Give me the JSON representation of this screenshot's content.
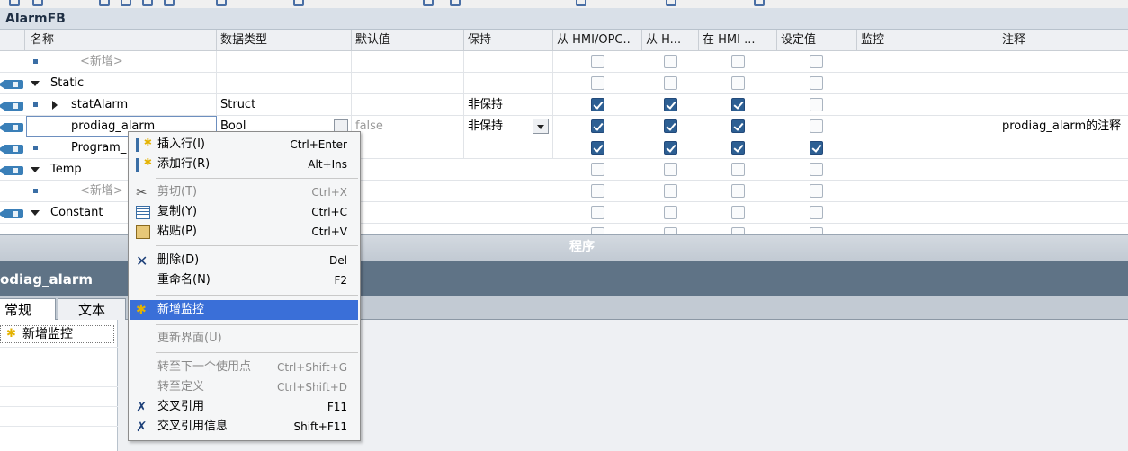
{
  "block": {
    "title": "AlarmFB"
  },
  "table": {
    "columns": [
      "名称",
      "数据类型",
      "默认值",
      "保持",
      "从 HMI/OPC..",
      "从 H...",
      "在 HMI ...",
      "设定值",
      "监控",
      "注释"
    ],
    "rows": [
      {
        "name": "<新增>",
        "type": "",
        "default": "",
        "retain": "",
        "hmi1": false,
        "hmi2": false,
        "hmi3": false,
        "setpoint": false,
        "comment": ""
      },
      {
        "name": "Static",
        "type": "",
        "default": "",
        "retain": "",
        "hmi1": false,
        "hmi2": false,
        "hmi3": false,
        "setpoint": false,
        "comment": ""
      },
      {
        "name": "statAlarm",
        "type": "Struct",
        "default": "",
        "retain": "非保持",
        "hmi1": true,
        "hmi2": true,
        "hmi3": true,
        "setpoint": false,
        "comment": ""
      },
      {
        "name": "prodiag_alarm",
        "type": "Bool",
        "default": "false",
        "retain": "非保持",
        "hmi1": true,
        "hmi2": true,
        "hmi3": true,
        "setpoint": false,
        "comment": "prodiag_alarm的注释"
      },
      {
        "name": "Program_",
        "type": "",
        "default": "",
        "retain": "",
        "hmi1": true,
        "hmi2": true,
        "hmi3": true,
        "setpoint": true,
        "comment": ""
      },
      {
        "name": "Temp",
        "type": "",
        "default": "",
        "retain": "",
        "hmi1": false,
        "hmi2": false,
        "hmi3": false,
        "setpoint": false,
        "comment": ""
      },
      {
        "name": "<新增>",
        "type": "",
        "default": "",
        "retain": "",
        "hmi1": false,
        "hmi2": false,
        "hmi3": false,
        "setpoint": false,
        "comment": ""
      },
      {
        "name": "Constant",
        "type": "",
        "default": "",
        "retain": "",
        "hmi1": false,
        "hmi2": false,
        "hmi3": false,
        "setpoint": false,
        "comment": ""
      }
    ]
  },
  "divider": {
    "label": "程序"
  },
  "inspector": {
    "title": "odiag_alarm",
    "tabs": [
      "常规",
      "文本"
    ],
    "side_item": "新增监控"
  },
  "context_menu": {
    "items": [
      {
        "label": "插入行(I)",
        "shortcut": "Ctrl+Enter",
        "icon": "insert-row-icon",
        "disabled": false
      },
      {
        "label": "添加行(R)",
        "shortcut": "Alt+Ins",
        "icon": "add-row-icon",
        "disabled": false
      },
      {
        "label": "剪切(T)",
        "shortcut": "Ctrl+X",
        "icon": "scissors-icon",
        "disabled": true
      },
      {
        "label": "复制(Y)",
        "shortcut": "Ctrl+C",
        "icon": "copy-icon",
        "disabled": false
      },
      {
        "label": "粘贴(P)",
        "shortcut": "Ctrl+V",
        "icon": "paste-icon",
        "disabled": false
      },
      {
        "label": "删除(D)",
        "shortcut": "Del",
        "icon": "delete-icon",
        "disabled": false
      },
      {
        "label": "重命名(N)",
        "shortcut": "F2",
        "icon": "",
        "disabled": false
      },
      {
        "label": "新增监控",
        "shortcut": "",
        "icon": "new-supervision-icon",
        "disabled": false,
        "highlighted": true
      },
      {
        "label": "更新界面(U)",
        "shortcut": "",
        "icon": "",
        "disabled": true
      },
      {
        "label": "转至下一个使用点",
        "shortcut": "Ctrl+Shift+G",
        "icon": "",
        "disabled": true
      },
      {
        "label": "转至定义",
        "shortcut": "Ctrl+Shift+D",
        "icon": "",
        "disabled": true
      },
      {
        "label": "交叉引用",
        "shortcut": "F11",
        "icon": "cross-reference-icon",
        "disabled": false
      },
      {
        "label": "交叉引用信息",
        "shortcut": "Shift+F11",
        "icon": "cross-reference-info-icon",
        "disabled": false
      }
    ]
  },
  "colors": {
    "highlight": "#3a6fd8",
    "checkbox_on": "#2d5f93",
    "inspector_title_bg": "#5f7386"
  }
}
